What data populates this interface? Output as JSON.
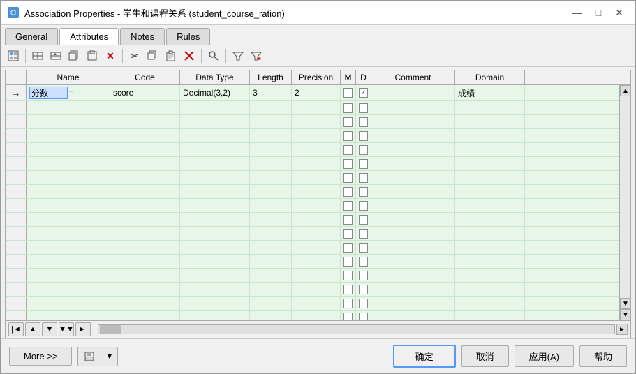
{
  "window": {
    "title": "Association Properties - 学生和课程关系 (student_course_ration)",
    "icon": "AP"
  },
  "titleControls": {
    "minimize": "—",
    "maximize": "□",
    "close": "✕"
  },
  "tabs": [
    {
      "label": "General",
      "active": false
    },
    {
      "label": "Attributes",
      "active": true
    },
    {
      "label": "Notes",
      "active": false
    },
    {
      "label": "Rules",
      "active": false
    }
  ],
  "toolbar": {
    "buttons": [
      {
        "name": "properties-icon",
        "icon": "⊞"
      },
      {
        "name": "separator1",
        "type": "sep"
      },
      {
        "name": "add-row-icon",
        "icon": "▦"
      },
      {
        "name": "insert-row-icon",
        "icon": "▦"
      },
      {
        "name": "copy-icon",
        "icon": "▦"
      },
      {
        "name": "delete-icon",
        "icon": "▦"
      },
      {
        "name": "separator2",
        "type": "sep"
      },
      {
        "name": "cut-icon",
        "icon": "✂"
      },
      {
        "name": "copy2-icon",
        "icon": "⧉"
      },
      {
        "name": "paste-icon",
        "icon": "📋"
      },
      {
        "name": "remove-icon",
        "icon": "✕"
      },
      {
        "name": "separator3",
        "type": "sep"
      },
      {
        "name": "find-icon",
        "icon": "🔍"
      },
      {
        "name": "separator4",
        "type": "sep"
      },
      {
        "name": "filter-icon",
        "icon": "≋"
      },
      {
        "name": "filter2-icon",
        "icon": "≋"
      }
    ]
  },
  "grid": {
    "columns": [
      {
        "id": "name",
        "label": "Name",
        "class": "col-name"
      },
      {
        "id": "code",
        "label": "Code",
        "class": "col-code"
      },
      {
        "id": "datatype",
        "label": "Data Type",
        "class": "col-datatype"
      },
      {
        "id": "length",
        "label": "Length",
        "class": "col-length"
      },
      {
        "id": "precision",
        "label": "Precision",
        "class": "col-precision"
      },
      {
        "id": "m",
        "label": "M",
        "class": "col-m"
      },
      {
        "id": "d",
        "label": "D",
        "class": "col-d"
      },
      {
        "id": "comment",
        "label": "Comment",
        "class": "col-comment"
      },
      {
        "id": "domain",
        "label": "Domain",
        "class": "col-domain"
      }
    ],
    "rows": [
      {
        "indicator": "→",
        "name": "分数",
        "code": "score",
        "datatype": "Decimal(3,2)",
        "length": "3",
        "precision": "2",
        "m": false,
        "d": true,
        "comment": "",
        "domain": "成绩"
      }
    ],
    "emptyRows": 17
  },
  "navButtons": [
    {
      "name": "nav-first",
      "icon": "⇤"
    },
    {
      "name": "nav-up",
      "icon": "↑"
    },
    {
      "name": "nav-down",
      "icon": "↓"
    },
    {
      "name": "nav-next",
      "icon": "↓↓"
    },
    {
      "name": "nav-last",
      "icon": "⇥"
    }
  ],
  "bottomBar": {
    "more": "More >>",
    "ok": "确定",
    "cancel": "取消",
    "apply": "应用(A)",
    "help": "帮助"
  }
}
